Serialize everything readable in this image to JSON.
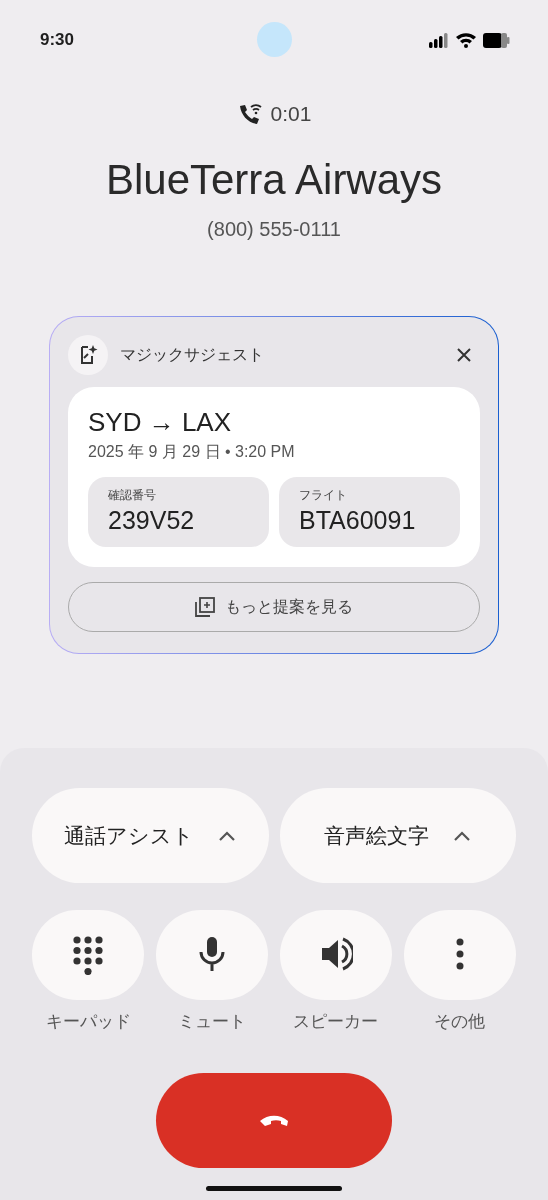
{
  "status_bar": {
    "time": "9:30"
  },
  "call": {
    "timer": "0:01",
    "name": "BlueTerra Airways",
    "number": "(800) 555-0111"
  },
  "suggestion": {
    "title": "マジックサジェスト",
    "route": "SYD → LAX",
    "datetime": "2025 年 9 月 29 日 • 3:20 PM",
    "fields": [
      {
        "label": "確認番号",
        "value": "239V52"
      },
      {
        "label": "フライト",
        "value": "BTA60091"
      }
    ],
    "more_button": "もっと提案を見る"
  },
  "pills": [
    {
      "label": "通話アシスト",
      "expanded": true
    },
    {
      "label": "音声絵文字",
      "expanded": true
    }
  ],
  "actions": [
    {
      "label": "キーパッド"
    },
    {
      "label": "ミュート"
    },
    {
      "label": "スピーカー"
    },
    {
      "label": "その他"
    }
  ]
}
